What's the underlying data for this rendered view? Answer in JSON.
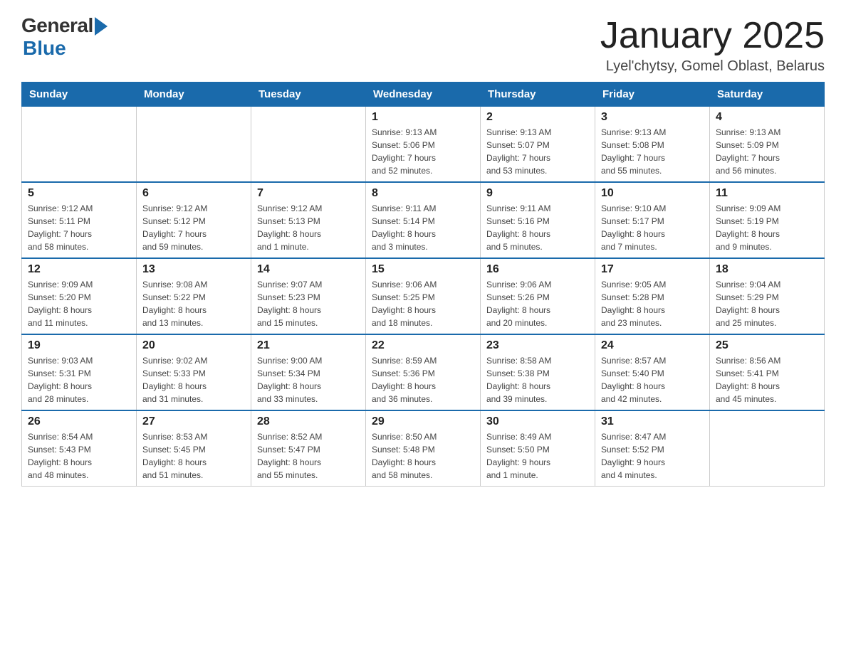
{
  "header": {
    "title": "January 2025",
    "subtitle": "Lyel'chytsy, Gomel Oblast, Belarus",
    "logo_general": "General",
    "logo_blue": "Blue"
  },
  "days_of_week": [
    "Sunday",
    "Monday",
    "Tuesday",
    "Wednesday",
    "Thursday",
    "Friday",
    "Saturday"
  ],
  "weeks": [
    {
      "days": [
        {
          "num": "",
          "info": ""
        },
        {
          "num": "",
          "info": ""
        },
        {
          "num": "",
          "info": ""
        },
        {
          "num": "1",
          "info": "Sunrise: 9:13 AM\nSunset: 5:06 PM\nDaylight: 7 hours\nand 52 minutes."
        },
        {
          "num": "2",
          "info": "Sunrise: 9:13 AM\nSunset: 5:07 PM\nDaylight: 7 hours\nand 53 minutes."
        },
        {
          "num": "3",
          "info": "Sunrise: 9:13 AM\nSunset: 5:08 PM\nDaylight: 7 hours\nand 55 minutes."
        },
        {
          "num": "4",
          "info": "Sunrise: 9:13 AM\nSunset: 5:09 PM\nDaylight: 7 hours\nand 56 minutes."
        }
      ]
    },
    {
      "days": [
        {
          "num": "5",
          "info": "Sunrise: 9:12 AM\nSunset: 5:11 PM\nDaylight: 7 hours\nand 58 minutes."
        },
        {
          "num": "6",
          "info": "Sunrise: 9:12 AM\nSunset: 5:12 PM\nDaylight: 7 hours\nand 59 minutes."
        },
        {
          "num": "7",
          "info": "Sunrise: 9:12 AM\nSunset: 5:13 PM\nDaylight: 8 hours\nand 1 minute."
        },
        {
          "num": "8",
          "info": "Sunrise: 9:11 AM\nSunset: 5:14 PM\nDaylight: 8 hours\nand 3 minutes."
        },
        {
          "num": "9",
          "info": "Sunrise: 9:11 AM\nSunset: 5:16 PM\nDaylight: 8 hours\nand 5 minutes."
        },
        {
          "num": "10",
          "info": "Sunrise: 9:10 AM\nSunset: 5:17 PM\nDaylight: 8 hours\nand 7 minutes."
        },
        {
          "num": "11",
          "info": "Sunrise: 9:09 AM\nSunset: 5:19 PM\nDaylight: 8 hours\nand 9 minutes."
        }
      ]
    },
    {
      "days": [
        {
          "num": "12",
          "info": "Sunrise: 9:09 AM\nSunset: 5:20 PM\nDaylight: 8 hours\nand 11 minutes."
        },
        {
          "num": "13",
          "info": "Sunrise: 9:08 AM\nSunset: 5:22 PM\nDaylight: 8 hours\nand 13 minutes."
        },
        {
          "num": "14",
          "info": "Sunrise: 9:07 AM\nSunset: 5:23 PM\nDaylight: 8 hours\nand 15 minutes."
        },
        {
          "num": "15",
          "info": "Sunrise: 9:06 AM\nSunset: 5:25 PM\nDaylight: 8 hours\nand 18 minutes."
        },
        {
          "num": "16",
          "info": "Sunrise: 9:06 AM\nSunset: 5:26 PM\nDaylight: 8 hours\nand 20 minutes."
        },
        {
          "num": "17",
          "info": "Sunrise: 9:05 AM\nSunset: 5:28 PM\nDaylight: 8 hours\nand 23 minutes."
        },
        {
          "num": "18",
          "info": "Sunrise: 9:04 AM\nSunset: 5:29 PM\nDaylight: 8 hours\nand 25 minutes."
        }
      ]
    },
    {
      "days": [
        {
          "num": "19",
          "info": "Sunrise: 9:03 AM\nSunset: 5:31 PM\nDaylight: 8 hours\nand 28 minutes."
        },
        {
          "num": "20",
          "info": "Sunrise: 9:02 AM\nSunset: 5:33 PM\nDaylight: 8 hours\nand 31 minutes."
        },
        {
          "num": "21",
          "info": "Sunrise: 9:00 AM\nSunset: 5:34 PM\nDaylight: 8 hours\nand 33 minutes."
        },
        {
          "num": "22",
          "info": "Sunrise: 8:59 AM\nSunset: 5:36 PM\nDaylight: 8 hours\nand 36 minutes."
        },
        {
          "num": "23",
          "info": "Sunrise: 8:58 AM\nSunset: 5:38 PM\nDaylight: 8 hours\nand 39 minutes."
        },
        {
          "num": "24",
          "info": "Sunrise: 8:57 AM\nSunset: 5:40 PM\nDaylight: 8 hours\nand 42 minutes."
        },
        {
          "num": "25",
          "info": "Sunrise: 8:56 AM\nSunset: 5:41 PM\nDaylight: 8 hours\nand 45 minutes."
        }
      ]
    },
    {
      "days": [
        {
          "num": "26",
          "info": "Sunrise: 8:54 AM\nSunset: 5:43 PM\nDaylight: 8 hours\nand 48 minutes."
        },
        {
          "num": "27",
          "info": "Sunrise: 8:53 AM\nSunset: 5:45 PM\nDaylight: 8 hours\nand 51 minutes."
        },
        {
          "num": "28",
          "info": "Sunrise: 8:52 AM\nSunset: 5:47 PM\nDaylight: 8 hours\nand 55 minutes."
        },
        {
          "num": "29",
          "info": "Sunrise: 8:50 AM\nSunset: 5:48 PM\nDaylight: 8 hours\nand 58 minutes."
        },
        {
          "num": "30",
          "info": "Sunrise: 8:49 AM\nSunset: 5:50 PM\nDaylight: 9 hours\nand 1 minute."
        },
        {
          "num": "31",
          "info": "Sunrise: 8:47 AM\nSunset: 5:52 PM\nDaylight: 9 hours\nand 4 minutes."
        },
        {
          "num": "",
          "info": ""
        }
      ]
    }
  ]
}
